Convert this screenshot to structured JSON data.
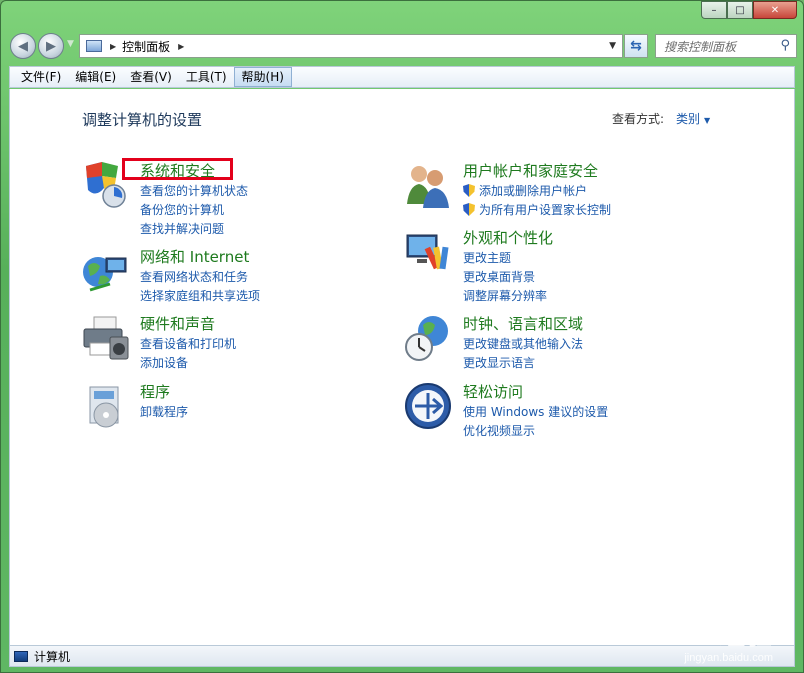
{
  "window": {
    "caption": {
      "minimize": "▭",
      "maximize": "◻",
      "close": "✕"
    }
  },
  "address": {
    "crumb": "控制面板",
    "search_placeholder": "搜索控制面板"
  },
  "menubar": {
    "items": [
      "文件(F)",
      "编辑(E)",
      "查看(V)",
      "工具(T)",
      "帮助(H)"
    ],
    "active_index": 4
  },
  "main": {
    "title": "调整计算机的设置",
    "view_by_label": "查看方式:",
    "view_by_value": "类别"
  },
  "categories": [
    {
      "title": "系统和安全",
      "icon": "security-shield-icon",
      "links": [
        "查看您的计算机状态",
        "备份您的计算机",
        "查找并解决问题"
      ]
    },
    {
      "title": "网络和 Internet",
      "icon": "network-globe-icon",
      "links": [
        "查看网络状态和任务",
        "选择家庭组和共享选项"
      ]
    },
    {
      "title": "硬件和声音",
      "icon": "printer-icon",
      "links": [
        "查看设备和打印机",
        "添加设备"
      ]
    },
    {
      "title": "程序",
      "icon": "programs-disc-icon",
      "links": [
        "卸载程序"
      ]
    },
    {
      "title": "用户帐户和家庭安全",
      "icon": "users-icon",
      "links": [
        "添加或删除用户帐户",
        "为所有用户设置家长控制"
      ]
    },
    {
      "title": "外观和个性化",
      "icon": "display-palette-icon",
      "links": [
        "更改主题",
        "更改桌面背景",
        "调整屏幕分辨率"
      ]
    },
    {
      "title": "时钟、语言和区域",
      "icon": "clock-globe-icon",
      "links": [
        "更改键盘或其他输入法",
        "更改显示语言"
      ]
    },
    {
      "title": "轻松访问",
      "icon": "ease-of-access-icon",
      "links": [
        "使用 Windows 建议的设置",
        "优化视频显示"
      ]
    }
  ],
  "statusbar": {
    "text": "计算机"
  },
  "watermark": {
    "brand": "Baidu经验",
    "url": "jingyan.baidu.com"
  },
  "colors": {
    "accent_link": "#1d5aab",
    "category_title": "#1e7a1e",
    "highlight": "#e3001b"
  }
}
